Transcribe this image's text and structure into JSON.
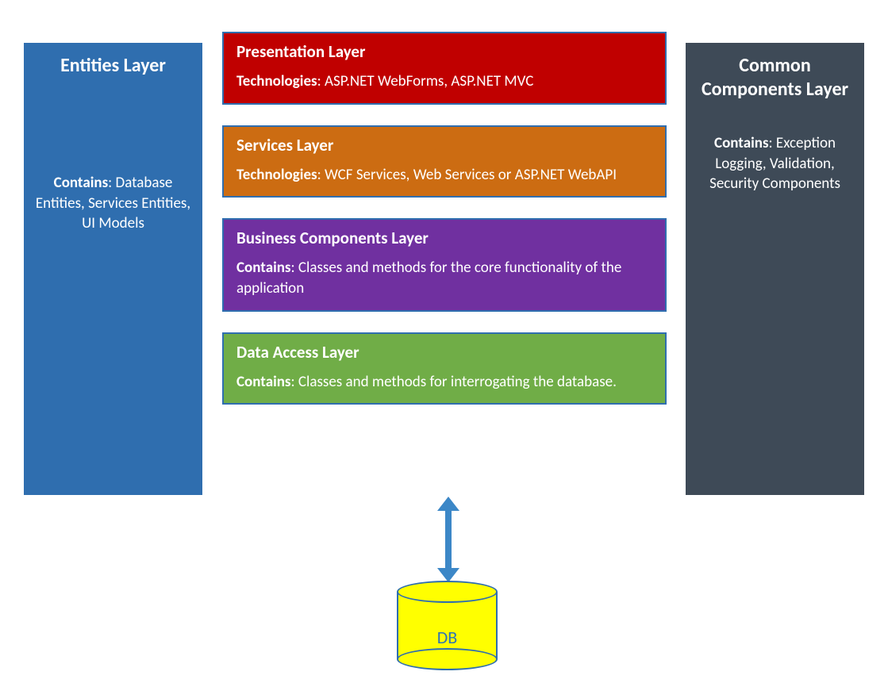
{
  "entities": {
    "title": "Entities Layer",
    "body_label": "Contains",
    "body_text": ": Database Entities, Services Entities, UI Models"
  },
  "common": {
    "title": "Common Components Layer",
    "body_label": "Contains",
    "body_text": ": Exception Logging, Validation, Security Components"
  },
  "layers": {
    "presentation": {
      "title": "Presentation Layer",
      "body_label": "Technologies",
      "body_text": ": ASP.NET WebForms, ASP.NET MVC"
    },
    "services": {
      "title": "Services Layer",
      "body_label": "Technologies",
      "body_text": ": WCF Services, Web Services or ASP.NET WebAPI"
    },
    "business": {
      "title": "Business Components Layer",
      "body_label": "Contains",
      "body_text": ": Classes and methods for the core functionality of the application"
    },
    "data_access": {
      "title": "Data Access Layer",
      "body_label": "Contains",
      "body_text": ": Classes and methods for interrogating the database."
    }
  },
  "db": {
    "label": "DB"
  }
}
